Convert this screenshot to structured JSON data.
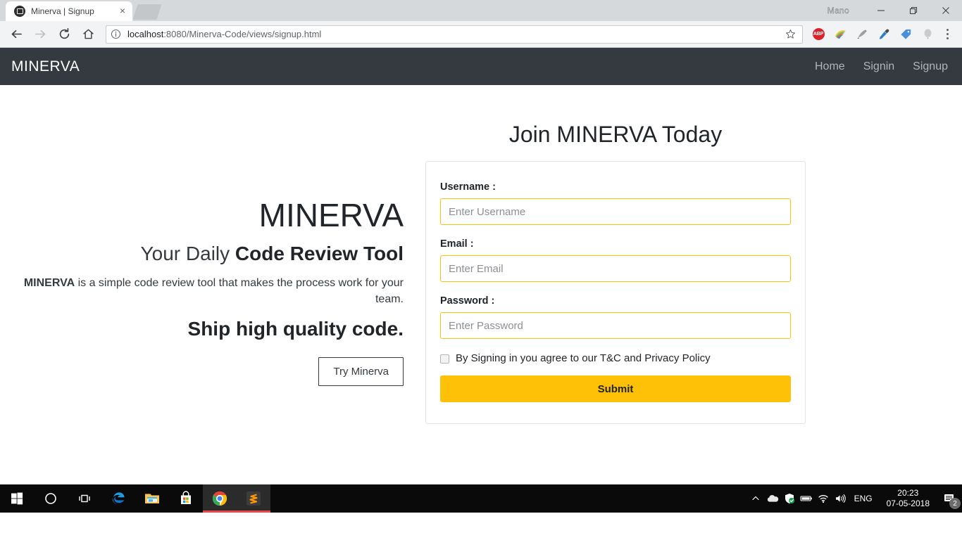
{
  "browser": {
    "tab": {
      "title": "Minerva | Signup",
      "favicon": "minerva-favicon",
      "close": "×"
    },
    "new_tab_label": "+",
    "profile_name": "Mano",
    "window_controls": {
      "minimize": "—",
      "maximize": "❐",
      "close": "✕"
    },
    "url": {
      "host": "localhost",
      "path": ":8080/Minerva-Code/views/signup.html"
    },
    "nav": {
      "back": "back-icon",
      "forward": "forward-icon",
      "reload": "reload-icon",
      "home": "home-icon"
    },
    "omnibox": {
      "info_icon": "page-info-icon",
      "star_icon": "bookmark-star-icon"
    },
    "extensions": [
      {
        "name": "adblock-plus",
        "label": "ABP"
      },
      {
        "name": "colorzilla",
        "label": ""
      },
      {
        "name": "whatfont",
        "label": ""
      },
      {
        "name": "eyedropper",
        "label": ""
      },
      {
        "name": "tag-assistant",
        "label": ""
      },
      {
        "name": "balloon-extension",
        "label": ""
      }
    ],
    "menu": "chrome-menu-icon"
  },
  "navbar": {
    "brand": "MINERVA",
    "links": [
      {
        "label": "Home"
      },
      {
        "label": "Signin"
      },
      {
        "label": "Signup"
      }
    ]
  },
  "hero": {
    "title": "MINERVA",
    "subtitle_light": "Your Daily ",
    "subtitle_bold": "Code Review Tool",
    "description_bold": "MINERVA",
    "description_rest": " is a simple code review tool that makes the process work for your team.",
    "tagline": "Ship high quality code.",
    "cta_label": "Try Minerva"
  },
  "form": {
    "heading": "Join MINERVA Today",
    "fields": [
      {
        "label": "Username :",
        "placeholder": "Enter Username",
        "value": "",
        "type": "text",
        "name": "username"
      },
      {
        "label": "Email :",
        "placeholder": "Enter Email",
        "value": "",
        "type": "text",
        "name": "email"
      },
      {
        "label": "Password :",
        "placeholder": "Enter Password",
        "value": "",
        "type": "password",
        "name": "password"
      }
    ],
    "terms_label": "By Signing in you agree to our T&C and Privacy Policy",
    "terms_checked": false,
    "submit_label": "Submit"
  },
  "taskbar": {
    "buttons": [
      {
        "name": "start-button",
        "icon": "windows-logo-icon",
        "active": false
      },
      {
        "name": "cortana-button",
        "icon": "cortana-circle-icon",
        "active": false
      },
      {
        "name": "task-view-button",
        "icon": "task-view-icon",
        "active": false
      },
      {
        "name": "edge-button",
        "icon": "edge-icon",
        "active": false
      },
      {
        "name": "file-explorer-button",
        "icon": "folder-icon",
        "active": false
      },
      {
        "name": "microsoft-store-button",
        "icon": "store-bag-icon",
        "active": false
      },
      {
        "name": "chrome-button",
        "icon": "chrome-icon",
        "active": true
      },
      {
        "name": "sublime-text-button",
        "icon": "sublime-text-icon",
        "active": true
      }
    ],
    "tray": {
      "show_hidden": "chevron-up-icon",
      "icons": [
        "onedrive-cloud-icon",
        "defender-shield-icon",
        "battery-icon",
        "wifi-icon",
        "volume-icon"
      ],
      "language": "ENG",
      "time": "20:23",
      "date": "07-05-2018",
      "notification_count": "2"
    }
  },
  "colors": {
    "navbar_bg": "#343a40",
    "accent": "#ffc107",
    "nav_link": "#adb5bd",
    "card_border": "#e3e3e3",
    "taskbar_bg": "#0a0a0a"
  }
}
